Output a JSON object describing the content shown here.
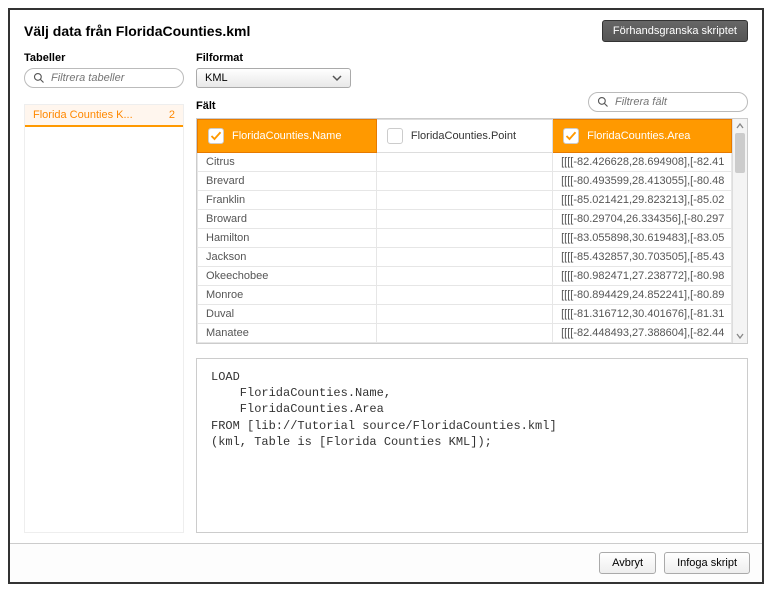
{
  "title": "Välj data från FloridaCounties.kml",
  "buttons": {
    "preview": "Förhandsgranska skriptet",
    "cancel": "Avbryt",
    "insert": "Infoga skript"
  },
  "labels": {
    "tables": "Tabeller",
    "fileformat": "Filformat",
    "fields": "Fält"
  },
  "search": {
    "tables_placeholder": "Filtrera tabeller",
    "fields_placeholder": "Filtrera fält"
  },
  "fileformat": {
    "selected": "KML"
  },
  "tables": [
    {
      "name": "Florida Counties K...",
      "count": "2"
    }
  ],
  "columns": [
    {
      "label": "FloridaCounties.Name",
      "selected": true
    },
    {
      "label": "FloridaCounties.Point",
      "selected": false
    },
    {
      "label": "FloridaCounties.Area",
      "selected": true
    }
  ],
  "rows": [
    {
      "name": "Citrus",
      "point": "",
      "area": "[[[[-82.426628,28.694908],[-82.41"
    },
    {
      "name": "Brevard",
      "point": "",
      "area": "[[[[-80.493599,28.413055],[-80.48"
    },
    {
      "name": "Franklin",
      "point": "",
      "area": "[[[[-85.021421,29.823213],[-85.02"
    },
    {
      "name": "Broward",
      "point": "",
      "area": "[[[[-80.29704,26.334356],[-80.297"
    },
    {
      "name": "Hamilton",
      "point": "",
      "area": "[[[[-83.055898,30.619483],[-83.05"
    },
    {
      "name": "Jackson",
      "point": "",
      "area": "[[[[-85.432857,30.703505],[-85.43"
    },
    {
      "name": "Okeechobee",
      "point": "",
      "area": "[[[[-80.982471,27.238772],[-80.98"
    },
    {
      "name": "Monroe",
      "point": "",
      "area": "[[[[-80.894429,24.852241],[-80.89"
    },
    {
      "name": "Duval",
      "point": "",
      "area": "[[[[-81.316712,30.401676],[-81.31"
    },
    {
      "name": "Manatee",
      "point": "",
      "area": "[[[[-82.448493,27.388604],[-82.44"
    }
  ],
  "script": "LOAD\n    FloridaCounties.Name,\n    FloridaCounties.Area\nFROM [lib://Tutorial source/FloridaCounties.kml]\n(kml, Table is [Florida Counties KML]);"
}
